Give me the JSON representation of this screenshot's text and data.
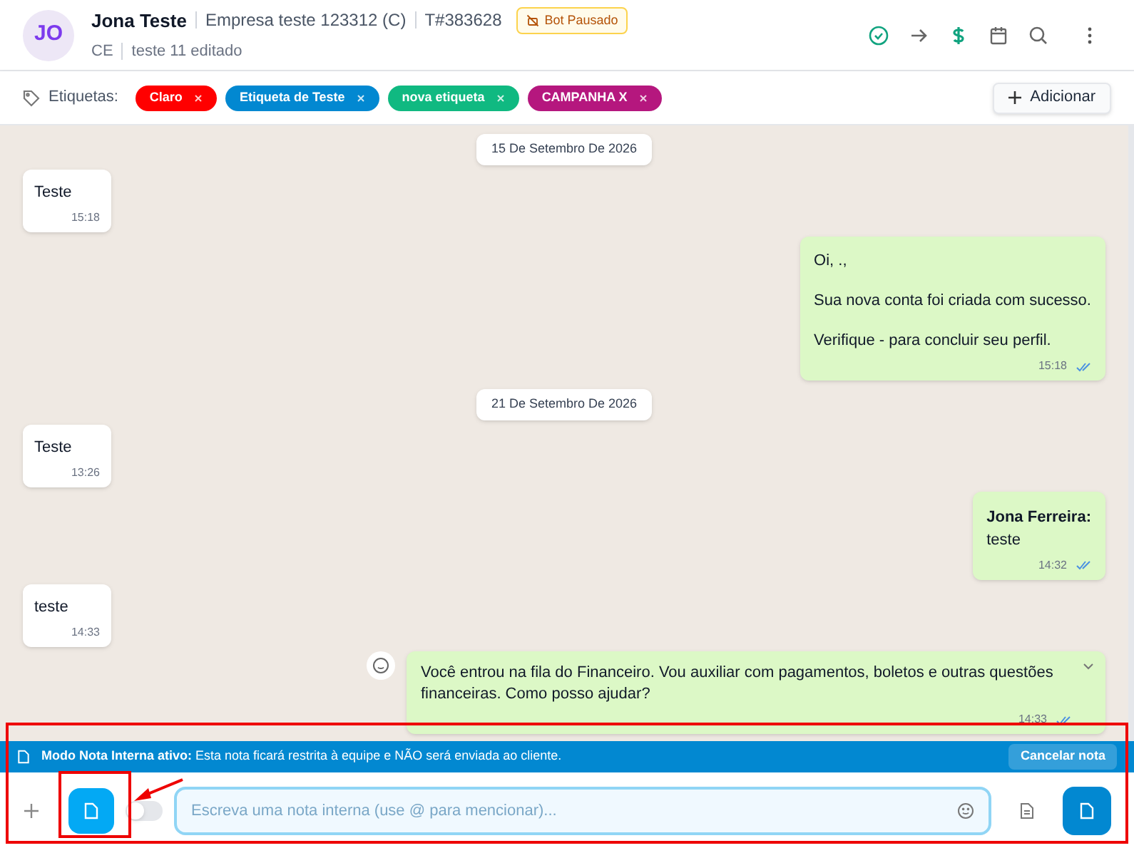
{
  "contact": {
    "initials": "JO",
    "name": "Jona Teste",
    "company": "Empresa teste 123312 (C)",
    "ticket": "T#383628",
    "badge": "Bot Pausado",
    "state": "CE",
    "note": "teste 11 editado"
  },
  "tags_label": "Etiquetas:",
  "tags": [
    {
      "label": "Claro",
      "color": "#ff0000"
    },
    {
      "label": "Etiqueta de Teste",
      "color": "#0288d1"
    },
    {
      "label": "nova etiqueta",
      "color": "#10b981"
    },
    {
      "label": "CAMPANHA X",
      "color": "#b5177e"
    }
  ],
  "add_tag": "Adicionar",
  "messages": [
    {
      "kind": "date",
      "text": "15 De Setembro De 2026"
    },
    {
      "kind": "in",
      "text": "Teste",
      "time": "15:18"
    },
    {
      "kind": "out",
      "lines": [
        "Oi, .,",
        "Sua nova conta foi criada com sucesso.",
        "Verifique - para concluir seu perfil."
      ],
      "spaced": true,
      "time": "15:18",
      "read": true
    },
    {
      "kind": "date",
      "text": "21 De Setembro De 2026"
    },
    {
      "kind": "in",
      "text": "Teste",
      "time": "13:26"
    },
    {
      "kind": "out",
      "author": "Jona Ferreira:",
      "lines": [
        "teste"
      ],
      "time": "14:32",
      "read": true
    },
    {
      "kind": "in",
      "text": "teste",
      "time": "14:33"
    },
    {
      "kind": "bot",
      "lines": [
        "Você entrou na fila do Financeiro. Vou auxiliar com pagamentos, boletos e outras questões financeiras. Como posso ajudar?"
      ],
      "time": "14:33",
      "read": true
    }
  ],
  "note_bar": {
    "text": "**Modo Nota Interna ativo:** Esta nota ficará restrita à equipe e NÃO será enviada ao cliente.",
    "cancel": "Cancelar nota"
  },
  "composer": {
    "placeholder": "Escreva uma nota interna (use @ para mencionar)...",
    "toggle_on": false
  }
}
